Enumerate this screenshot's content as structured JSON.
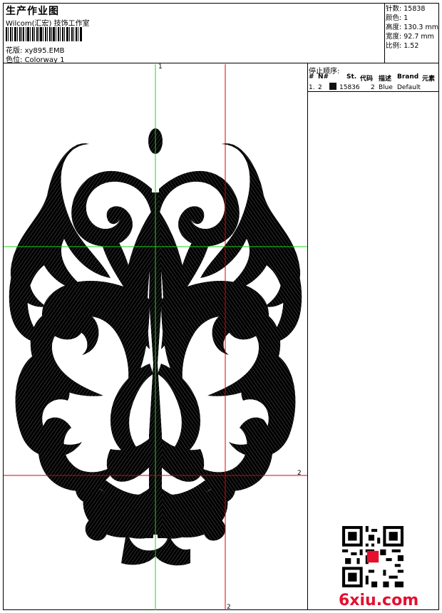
{
  "header": {
    "title": "生产作业图",
    "company": "Wilcom(汇宏) 技饰工作室",
    "design_label": "花版:",
    "design_value": "xy895.EMB",
    "colorway_label": "色位:",
    "colorway_value": "Colorway 1"
  },
  "stats": [
    {
      "label": "针数:",
      "value": "15838"
    },
    {
      "label": "颜色:",
      "value": "1"
    },
    {
      "label": "高度:",
      "value": "130.3 mm"
    },
    {
      "label": "宽度:",
      "value": "92.7 mm"
    },
    {
      "label": "比例:",
      "value": "1.52"
    }
  ],
  "stop_sequence": {
    "title": "停止顺序:",
    "headers": [
      "#",
      "N#",
      "St.",
      "代码",
      "描述",
      "Brand",
      "元素"
    ],
    "rows": [
      {
        "index": "1.",
        "needle": "2",
        "stitches": "15836",
        "code": "2",
        "description": "Blue",
        "brand": "Default",
        "swatch": "#111111"
      }
    ]
  },
  "guides": {
    "vertical_1": "1",
    "horizontal_2": "2",
    "vertical_2": "2",
    "green": "#18d818",
    "red": "#e00000"
  },
  "watermark": {
    "text": "6xiu.com",
    "color": "#e3102e"
  },
  "design": {
    "fill": "#000000"
  }
}
